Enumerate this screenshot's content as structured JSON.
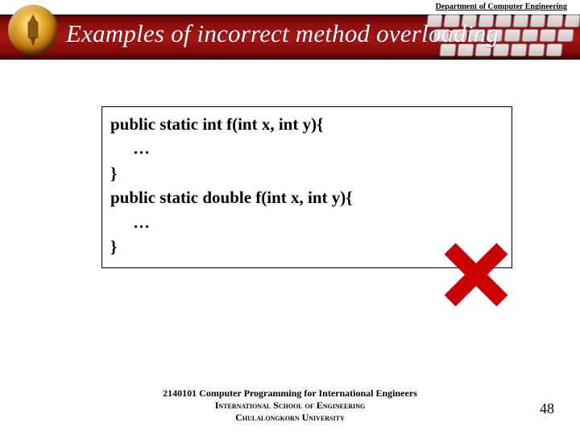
{
  "header": {
    "department": "Department of Computer Engineering",
    "title": "Examples of incorrect method overloading"
  },
  "code": {
    "line1": "public static int f(int x, int y){",
    "line2": "…",
    "line3": "}",
    "line4": "public static double f(int x, int y){",
    "line5": "…",
    "line6": "}"
  },
  "mark": {
    "name": "incorrect-cross",
    "color": "#cc0000"
  },
  "footer": {
    "course": "2140101 Computer Programming for International Engineers",
    "school": "International School of Engineering",
    "university": "Chulalongkorn University",
    "page": "48"
  }
}
